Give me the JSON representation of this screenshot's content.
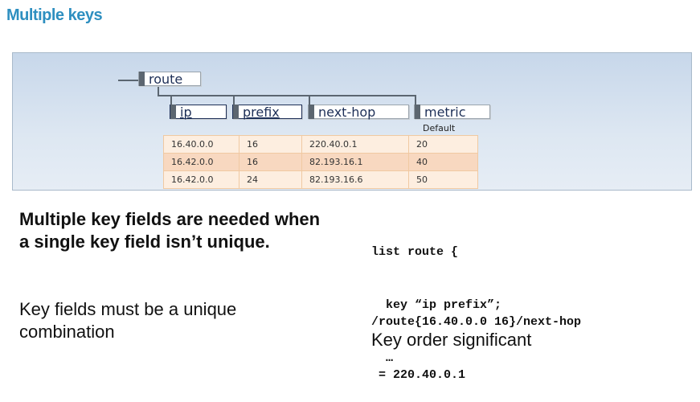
{
  "title": "Multiple keys",
  "tree": {
    "root": "route",
    "children": [
      {
        "label": "ip",
        "is_key": true
      },
      {
        "label": "prefix",
        "is_key": true
      },
      {
        "label": "next-hop",
        "is_key": false
      },
      {
        "label": "metric",
        "is_key": false
      }
    ],
    "default_label": "Default"
  },
  "table": {
    "rows": [
      [
        "16.40.0.0",
        "16",
        "220.40.0.1",
        "20"
      ],
      [
        "16.42.0.0",
        "16",
        "82.193.16.1",
        "40"
      ],
      [
        "16.42.0.0",
        "24",
        "82.193.16.6",
        "50"
      ]
    ]
  },
  "left_text": {
    "bold": "Multiple key fields are needed when a single key field isn’t unique.",
    "plain": "Key fields must be a unique combination"
  },
  "code": {
    "block1": [
      "list route {",
      "  key “ip prefix”;",
      "  …"
    ],
    "block2": [
      "/route{16.40.0.0 16}/next-hop",
      " = 220.40.0.1"
    ]
  },
  "bottom_right_text": "Key order significant",
  "colors": {
    "title": "#2e8fc0",
    "key_border": "#1d2f57",
    "row_light": "#fdeee0",
    "row_dark": "#f8d8c0"
  }
}
